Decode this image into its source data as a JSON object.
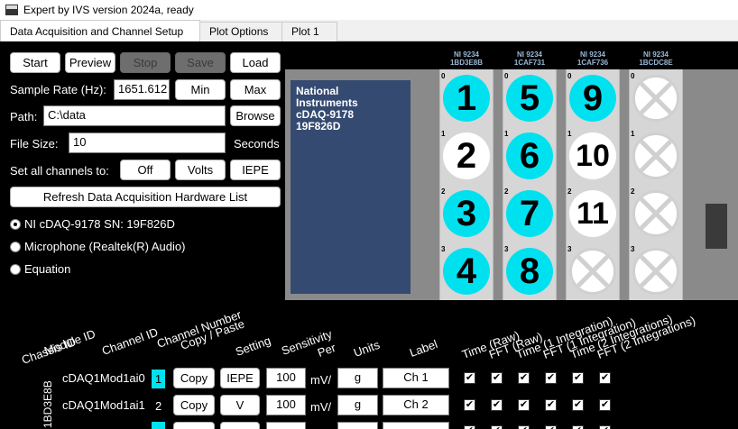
{
  "window": {
    "title": "Expert by IVS version 2024a, ready"
  },
  "tabs": [
    {
      "label": "Data Acquisition and Channel Setup"
    },
    {
      "label": "Plot Options"
    },
    {
      "label": "Plot 1"
    }
  ],
  "toolbar": {
    "start": "Start",
    "preview": "Preview",
    "stop": "Stop",
    "save": "Save",
    "load": "Load"
  },
  "sample_rate": {
    "label": "Sample Rate (Hz):",
    "value": "1651.612",
    "min": "Min",
    "max": "Max"
  },
  "path": {
    "label": "Path:",
    "value": "C:\\data",
    "browse": "Browse"
  },
  "file_size": {
    "label": "File Size:",
    "value": "10",
    "unit": "Seconds"
  },
  "set_all": {
    "label": "Set all channels to:",
    "off": "Off",
    "volts": "Volts",
    "iepe": "IEPE"
  },
  "refresh": "Refresh Data Acquisition Hardware List",
  "sources": [
    {
      "label": "NI cDAQ-9178 SN: 19F826D",
      "checked": true
    },
    {
      "label": "Microphone (Realtek(R) Audio)",
      "checked": false
    },
    {
      "label": "Equation",
      "checked": false
    }
  ],
  "chassis": {
    "label": "National\nInstruments\ncDAQ-9178\n19F826D"
  },
  "modules": [
    {
      "model": "NI 9234",
      "serial": "1BD3E8B",
      "channels": [
        {
          "idx": "0",
          "num": "1",
          "state": "on"
        },
        {
          "idx": "1",
          "num": "2",
          "state": "off"
        },
        {
          "idx": "2",
          "num": "3",
          "state": "on"
        },
        {
          "idx": "3",
          "num": "4",
          "state": "on"
        }
      ]
    },
    {
      "model": "NI 9234",
      "serial": "1CAF731",
      "channels": [
        {
          "idx": "0",
          "num": "5",
          "state": "on"
        },
        {
          "idx": "1",
          "num": "6",
          "state": "on"
        },
        {
          "idx": "2",
          "num": "7",
          "state": "on"
        },
        {
          "idx": "3",
          "num": "8",
          "state": "on"
        }
      ]
    },
    {
      "model": "NI 9234",
      "serial": "1CAF736",
      "channels": [
        {
          "idx": "0",
          "num": "9",
          "state": "on"
        },
        {
          "idx": "1",
          "num": "10",
          "state": "off"
        },
        {
          "idx": "2",
          "num": "11",
          "state": "off"
        },
        {
          "idx": "3",
          "num": "",
          "state": "empty"
        }
      ]
    },
    {
      "model": "NI 9234",
      "serial": "1BCDC8E",
      "channels": [
        {
          "idx": "0",
          "num": "",
          "state": "empty"
        },
        {
          "idx": "1",
          "num": "",
          "state": "empty"
        },
        {
          "idx": "2",
          "num": "",
          "state": "empty"
        },
        {
          "idx": "3",
          "num": "",
          "state": "empty"
        }
      ]
    }
  ],
  "table": {
    "headers": {
      "chassis_id": "Chassis ID",
      "module_id": "Module ID",
      "channel_id": "Channel ID",
      "channel_number": "Channel Number",
      "copy_paste": "Copy / Paste",
      "setting": "Setting",
      "sensitivity": "Sensitivity",
      "per": "Per",
      "units": "Units",
      "label": "Label",
      "time_raw": "Time (Raw)",
      "fft_raw": "FFT (Raw)",
      "time_1": "Time (1 Integration)",
      "fft_1": "FFT (1 Integration)",
      "time_2": "Time (2 Integrations)",
      "fft_2": "FFT (2 Integrations)"
    },
    "chassis_vertical": "1BD3E8B",
    "rows": [
      {
        "channel_id": "cDAQ1Mod1ai0",
        "num": "1",
        "highlight": true,
        "copy": "Copy",
        "setting": "IEPE",
        "sensitivity": "100",
        "per": "mV/",
        "units": "g",
        "label": "Ch 1"
      },
      {
        "channel_id": "cDAQ1Mod1ai1",
        "num": "2",
        "highlight": false,
        "copy": "Copy",
        "setting": "V",
        "sensitivity": "100",
        "per": "mV/",
        "units": "g",
        "label": "Ch 2"
      }
    ],
    "check_mark": "✔"
  },
  "colors": {
    "active_channel": "#00e1f0",
    "chassis_panel": "#354a70",
    "background": "#000000"
  }
}
